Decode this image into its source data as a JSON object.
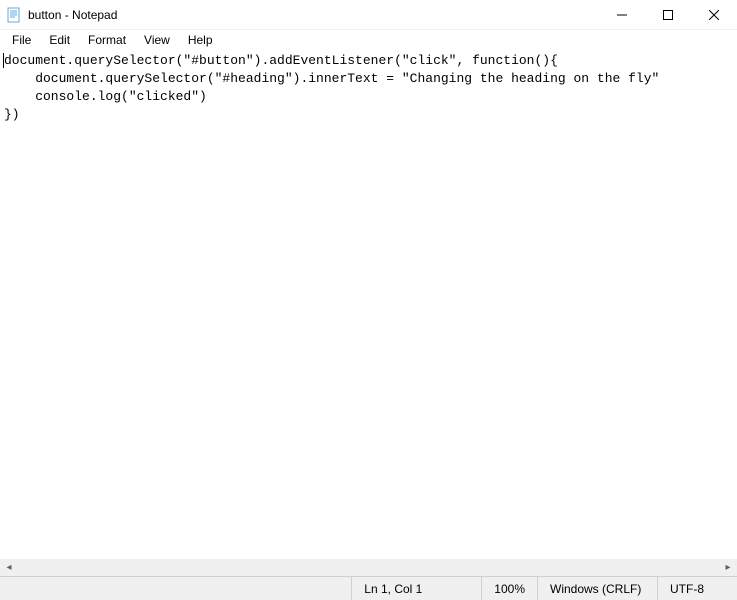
{
  "window": {
    "title": "button - Notepad"
  },
  "menu": {
    "file": "File",
    "edit": "Edit",
    "format": "Format",
    "view": "View",
    "help": "Help"
  },
  "document": {
    "line1": "document.querySelector(\"#button\").addEventListener(\"click\", function(){",
    "line2": "    document.querySelector(\"#heading\").innerText = \"Changing the heading on the fly\"",
    "line3": "    console.log(\"clicked\")",
    "line4": "})"
  },
  "status": {
    "position": "Ln 1, Col 1",
    "zoom": "100%",
    "eol": "Windows (CRLF)",
    "encoding": "UTF-8"
  }
}
